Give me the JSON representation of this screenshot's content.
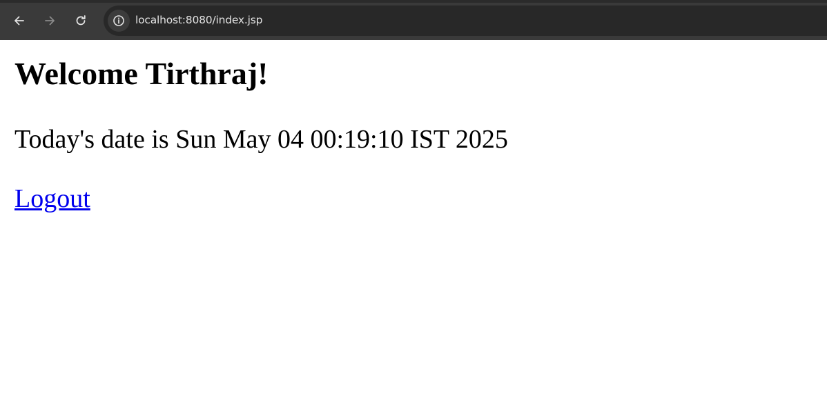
{
  "browser": {
    "url": "localhost:8080/index.jsp",
    "icons": {
      "back": "back-arrow-icon",
      "forward": "forward-arrow-icon",
      "reload": "reload-icon",
      "site_info": "info-icon"
    }
  },
  "page": {
    "heading": "Welcome Tirthraj!",
    "date_line": "Today's date is Sun May 04 00:19:10 IST 2025",
    "logout_label": "Logout"
  },
  "colors": {
    "toolbar": "#3a3a3a",
    "omnibox": "#282828",
    "link": "#0000ee"
  }
}
